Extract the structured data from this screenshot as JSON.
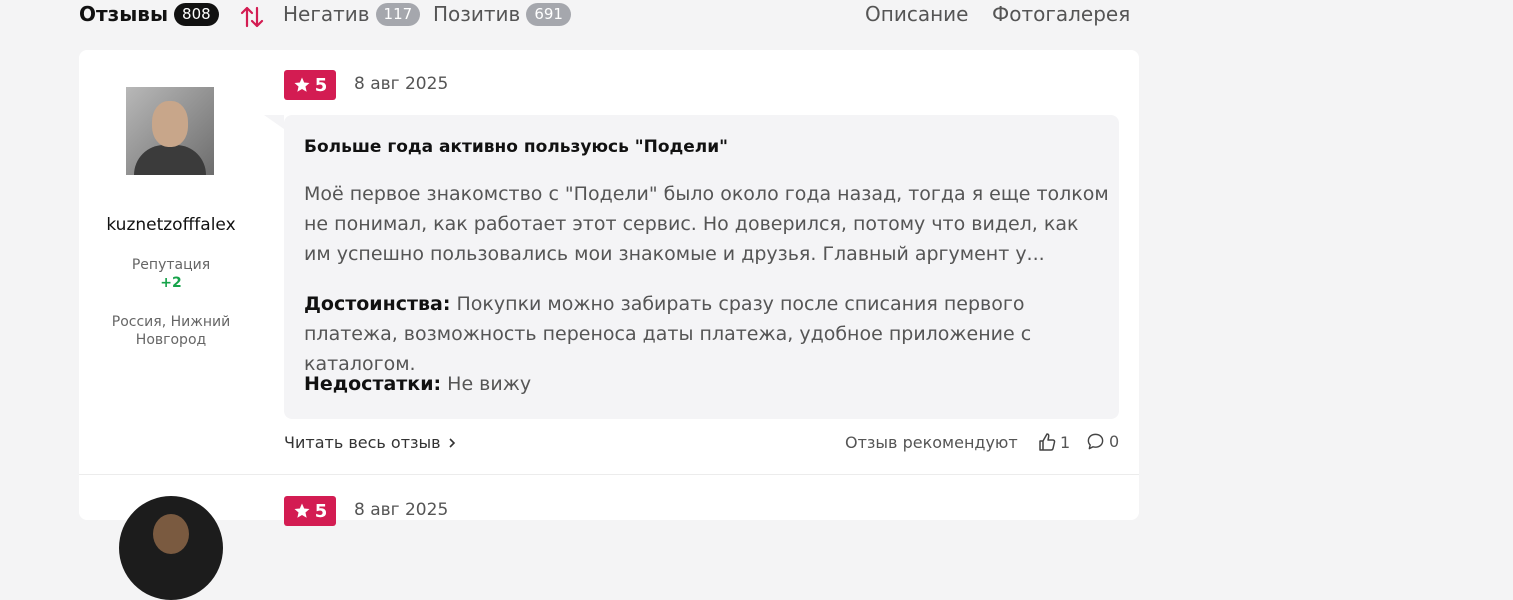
{
  "tabs": {
    "reviews": {
      "label": "Отзывы",
      "count": "808"
    },
    "negative": {
      "label": "Негатив",
      "count": "117"
    },
    "positive": {
      "label": "Позитив",
      "count": "691"
    }
  },
  "links": {
    "description": "Описание",
    "gallery": "Фотогалерея"
  },
  "reviews": [
    {
      "username": "kuznetzofffalex",
      "reputation_label": "Репутация",
      "reputation_value": "+2",
      "location": "Россия, Нижний Новгород",
      "rating": "5",
      "date": "8 авг 2025",
      "title": "Больше года активно пользуюсь \"Подели\"",
      "text": "Моё первое знакомство с \"Подели\" было около года назад, тогда я еще толком не понимал, как работает этот сервис. Но доверился, потому что видел, как им успешно пользовались мои знакомые и друзья. Главный аргумент у...",
      "pros_label": "Достоинства:",
      "pros": "Покупки можно забирать сразу после списания первого платежа, возможность переноса даты платежа, удобное приложение с каталогом.",
      "cons_label": "Недостатки:",
      "cons": "Не вижу",
      "read_more": "Читать весь отзыв",
      "recommend_label": "Отзыв рекомендуют",
      "likes": "1",
      "comments": "0"
    },
    {
      "rating": "5",
      "date": "8 авг 2025"
    }
  ],
  "colors": {
    "accent": "#d31c52",
    "reputation": "#16a34a",
    "badge": "#a5a7ad"
  },
  "icons": [
    "sort-icon",
    "star-icon",
    "chevron-right-icon",
    "thumbs-up-icon",
    "comment-icon"
  ]
}
